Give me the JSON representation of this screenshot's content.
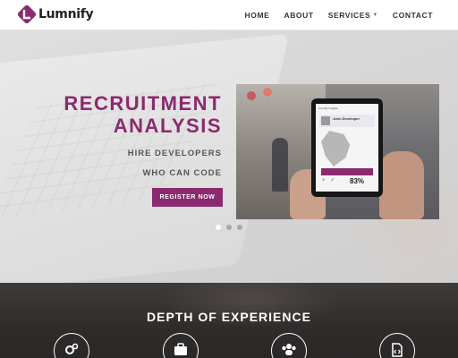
{
  "brand": {
    "name": "Lumnify",
    "accent": "#8b2a6e"
  },
  "nav": {
    "items": [
      {
        "label": "HOME"
      },
      {
        "label": "ABOUT"
      },
      {
        "label": "SERVICES"
      },
      {
        "label": "CONTACT"
      }
    ]
  },
  "hero": {
    "title_line1": "RECRUITMENT",
    "title_line2": "ANALYSIS",
    "subtitle_line1": "HIRE DEVELOPERS",
    "subtitle_line2": "WHO CAN CODE",
    "cta_label": "REGISTER NOW",
    "photo": {
      "screen_header": "Lumnify Insights",
      "candidate_name": "John Developer",
      "score": "83%"
    },
    "slides": {
      "count": 3,
      "active": 1
    }
  },
  "experience": {
    "title": "DEPTH OF EXPERIENCE",
    "features": [
      {
        "icon": "gears-icon"
      },
      {
        "icon": "briefcase-icon"
      },
      {
        "icon": "users-icon"
      },
      {
        "icon": "code-file-icon"
      }
    ]
  }
}
